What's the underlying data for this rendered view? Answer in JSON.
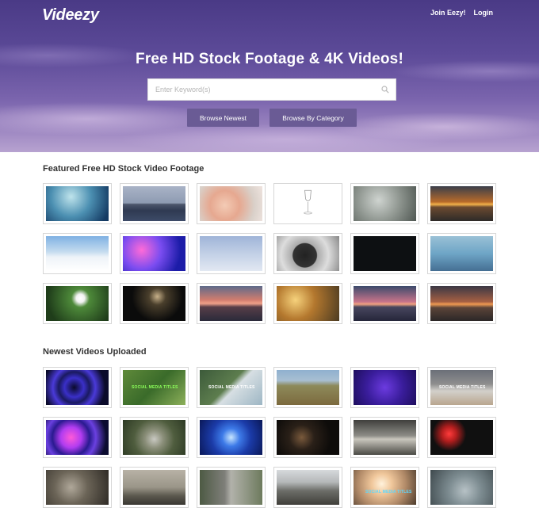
{
  "header": {
    "logo": "Videezy",
    "nav": [
      "Join Eezy!",
      "Login"
    ]
  },
  "hero": {
    "title": "Free HD Stock Footage & 4K Videos!",
    "search_placeholder": "Enter Keyword(s)",
    "buttons": [
      "Browse Newest",
      "Browse By Category"
    ]
  },
  "featured": {
    "title": "Featured Free HD Stock Video Footage",
    "thumbs": [
      "t-ice",
      "t-city",
      "t-hands",
      "t-glass",
      "t-fog",
      "t-sunset1",
      "t-snow",
      "t-lights",
      "t-sky",
      "t-vinyl",
      "t-dark",
      "t-bridge",
      "t-daisy",
      "t-nightlamp",
      "t-pinklake",
      "t-bokeh",
      "t-sunset2",
      "t-beach"
    ]
  },
  "newest": {
    "title": "Newest Videos Uploaded",
    "thumbs": [
      "t-rings1",
      "t-fox",
      "t-coast",
      "t-field",
      "t-purple",
      "t-mountain",
      "t-rings2",
      "t-aerial",
      "t-bluebeams",
      "t-nightcity",
      "t-rocks",
      "t-bokeh2",
      "t-debris",
      "t-reeds",
      "t-road",
      "t-ruins",
      "t-drink",
      "t-trash"
    ],
    "overlays": {
      "1": "SOCIAL MEDIA TITLES",
      "2": "SOCIAL MEDIA TITLES",
      "5": "SOCIAL MEDIA TITLES",
      "16": "SOCIAL MEDIA TITLES"
    }
  },
  "colors": {
    "button_bg": "#6a5b95",
    "hero_top": "#4a3a86",
    "hero_bottom": "#b7a2d0"
  }
}
